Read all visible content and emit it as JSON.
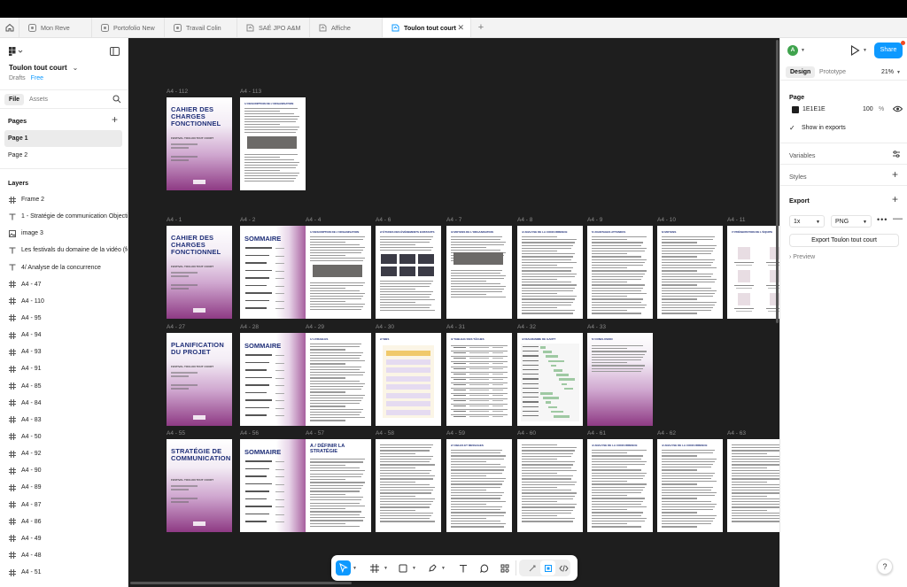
{
  "tabs": [
    {
      "label": "Mon Reve",
      "icon": "figjam-icon"
    },
    {
      "label": "Portofolio New",
      "icon": "figjam-icon"
    },
    {
      "label": "Travail Colin",
      "icon": "figjam-icon"
    },
    {
      "label": "SAÉ JPO A&M",
      "icon": "figma-file-icon"
    },
    {
      "label": "Affiche",
      "icon": "figma-file-icon"
    },
    {
      "label": "Toulon tout court",
      "icon": "figma-file-icon",
      "active": true
    }
  ],
  "file": {
    "name": "Toulon tout court",
    "location": "Drafts",
    "plan": "Free"
  },
  "left_tabs": {
    "file": "File",
    "assets": "Assets"
  },
  "pages": {
    "header": "Pages",
    "items": [
      "Page 1",
      "Page 2"
    ],
    "selected": "Page 1"
  },
  "layers": {
    "header": "Layers",
    "items": [
      {
        "label": "Frame 2",
        "icon": "frame"
      },
      {
        "label": "1 - Stratégie de communication Objectif",
        "icon": "text"
      },
      {
        "label": "image 3",
        "icon": "image"
      },
      {
        "label": "Les festivals du domaine de la vidéo (fe",
        "icon": "text"
      },
      {
        "label": "4/ Analyse de la concurrence",
        "icon": "text"
      },
      {
        "label": "A4 - 47",
        "icon": "frame"
      },
      {
        "label": "A4 - 110",
        "icon": "frame"
      },
      {
        "label": "A4 - 95",
        "icon": "frame"
      },
      {
        "label": "A4 - 94",
        "icon": "frame"
      },
      {
        "label": "A4 - 93",
        "icon": "frame"
      },
      {
        "label": "A4 - 91",
        "icon": "frame"
      },
      {
        "label": "A4 - 85",
        "icon": "frame"
      },
      {
        "label": "A4 - 84",
        "icon": "frame"
      },
      {
        "label": "A4 - 83",
        "icon": "frame"
      },
      {
        "label": "A4 - 50",
        "icon": "frame"
      },
      {
        "label": "A4 - 92",
        "icon": "frame"
      },
      {
        "label": "A4 - 90",
        "icon": "frame"
      },
      {
        "label": "A4 - 89",
        "icon": "frame"
      },
      {
        "label": "A4 - 87",
        "icon": "frame"
      },
      {
        "label": "A4 - 86",
        "icon": "frame"
      },
      {
        "label": "A4 - 49",
        "icon": "frame"
      },
      {
        "label": "A4 - 48",
        "icon": "frame"
      },
      {
        "label": "A4 - 51",
        "icon": "frame"
      }
    ]
  },
  "canvas": {
    "background": "#1E1E1E",
    "rows": [
      [
        {
          "label": "A4 - 112",
          "kind": "cover",
          "title": "CAHIER DES CHARGES FONCTIONNEL",
          "sub": "FESTIVAL TOULON TOUT COURT"
        },
        {
          "label": "A4 - 113",
          "kind": "text",
          "heading": "1/ DESCRIPTION DE L'ORGANISATION"
        }
      ],
      [
        {
          "label": "A4 - 1",
          "kind": "cover",
          "title": "CAHIER DES CHARGES FONCTIONNEL",
          "sub": "FESTIVAL TOULON TOUT COURT"
        },
        {
          "label": "A4 - 2",
          "kind": "sommaire",
          "title": "SOMMAIRE"
        },
        {
          "label": "A4 - 4",
          "kind": "text",
          "heading": "1/ DESCRIPTION DE L'ORGANISATION"
        },
        {
          "label": "A4 - 6",
          "kind": "text",
          "heading": "2/ ÉTUDES DES ÉVÉNEMENTS EXISTANTS"
        },
        {
          "label": "A4 - 7",
          "kind": "text",
          "heading": "3/ MOYENS DE L'ORGANISATION"
        },
        {
          "label": "A4 - 8",
          "kind": "text",
          "heading": "4/ ANALYSE DE LA CONCURRENCE"
        },
        {
          "label": "A4 - 9",
          "kind": "text",
          "heading": "5/ AVANTAGES ATTENDUS"
        },
        {
          "label": "A4 - 10",
          "kind": "text",
          "heading": "6/ MOYENS"
        },
        {
          "label": "A4 - 11",
          "kind": "team",
          "heading": "7/ PRÉSENTATION DE L'ÉQUIPE"
        }
      ],
      [
        {
          "label": "A4 - 27",
          "kind": "cover",
          "title": "PLANIFICATION DU PROJET",
          "sub": "FESTIVAL TOULON TOUT COURT"
        },
        {
          "label": "A4 - 28",
          "kind": "sommaire",
          "title": "SOMMAIRE"
        },
        {
          "label": "A4 - 29",
          "kind": "text",
          "heading": "1/ LIVRABLES"
        },
        {
          "label": "A4 - 30",
          "kind": "chart",
          "heading": "2/ WBS"
        },
        {
          "label": "A4 - 31",
          "kind": "table",
          "heading": "3/ TABLEAU DES TÂCHES"
        },
        {
          "label": "A4 - 32",
          "kind": "gantt",
          "heading": "4/ DIAGRAMME DE GANTT"
        },
        {
          "label": "A4 - 33",
          "kind": "closing",
          "heading": "5/ CONCLUSION"
        }
      ],
      [
        {
          "label": "A4 - 55",
          "kind": "cover",
          "title": "STRATÉGIE DE COMMUNICATION",
          "sub": "FESTIVAL TOULON TOUT COURT"
        },
        {
          "label": "A4 - 56",
          "kind": "sommaire",
          "title": "SOMMAIRE"
        },
        {
          "label": "A4 - 57",
          "kind": "text",
          "heading": "A / DÉFINIR LA STRATÉGIE"
        },
        {
          "label": "A4 - 58",
          "kind": "text",
          "heading": ""
        },
        {
          "label": "A4 - 59",
          "kind": "text",
          "heading": "2/ CIBLES ET MESSAGES"
        },
        {
          "label": "A4 - 60",
          "kind": "text",
          "heading": ""
        },
        {
          "label": "A4 - 61",
          "kind": "text",
          "heading": "4/ ANALYSE DE LA CONCURRENCE"
        },
        {
          "label": "A4 - 62",
          "kind": "text",
          "heading": "4/ ANALYSE DE LA CONCURRENCE"
        },
        {
          "label": "A4 - 63",
          "kind": "text",
          "heading": ""
        }
      ]
    ]
  },
  "toolbar": {
    "tools": [
      "move-tool",
      "frame-tool",
      "shape-tool",
      "pen-tool",
      "text-tool",
      "comment-tool",
      "actions-tool"
    ],
    "active": "move-tool"
  },
  "right": {
    "avatar_letter": "A",
    "share_label": "Share",
    "tabs": {
      "design": "Design",
      "prototype": "Prototype"
    },
    "zoom": "21%",
    "page_section": {
      "title": "Page",
      "color_hex": "1E1E1E",
      "opacity": "100",
      "percent": "%",
      "show_in_exports": "Show in exports"
    },
    "variables": "Variables",
    "styles": "Styles",
    "export": {
      "title": "Export",
      "scale": "1x",
      "format": "PNG",
      "button": "Export Toulon tout court",
      "preview": "Preview"
    },
    "help": "?"
  }
}
